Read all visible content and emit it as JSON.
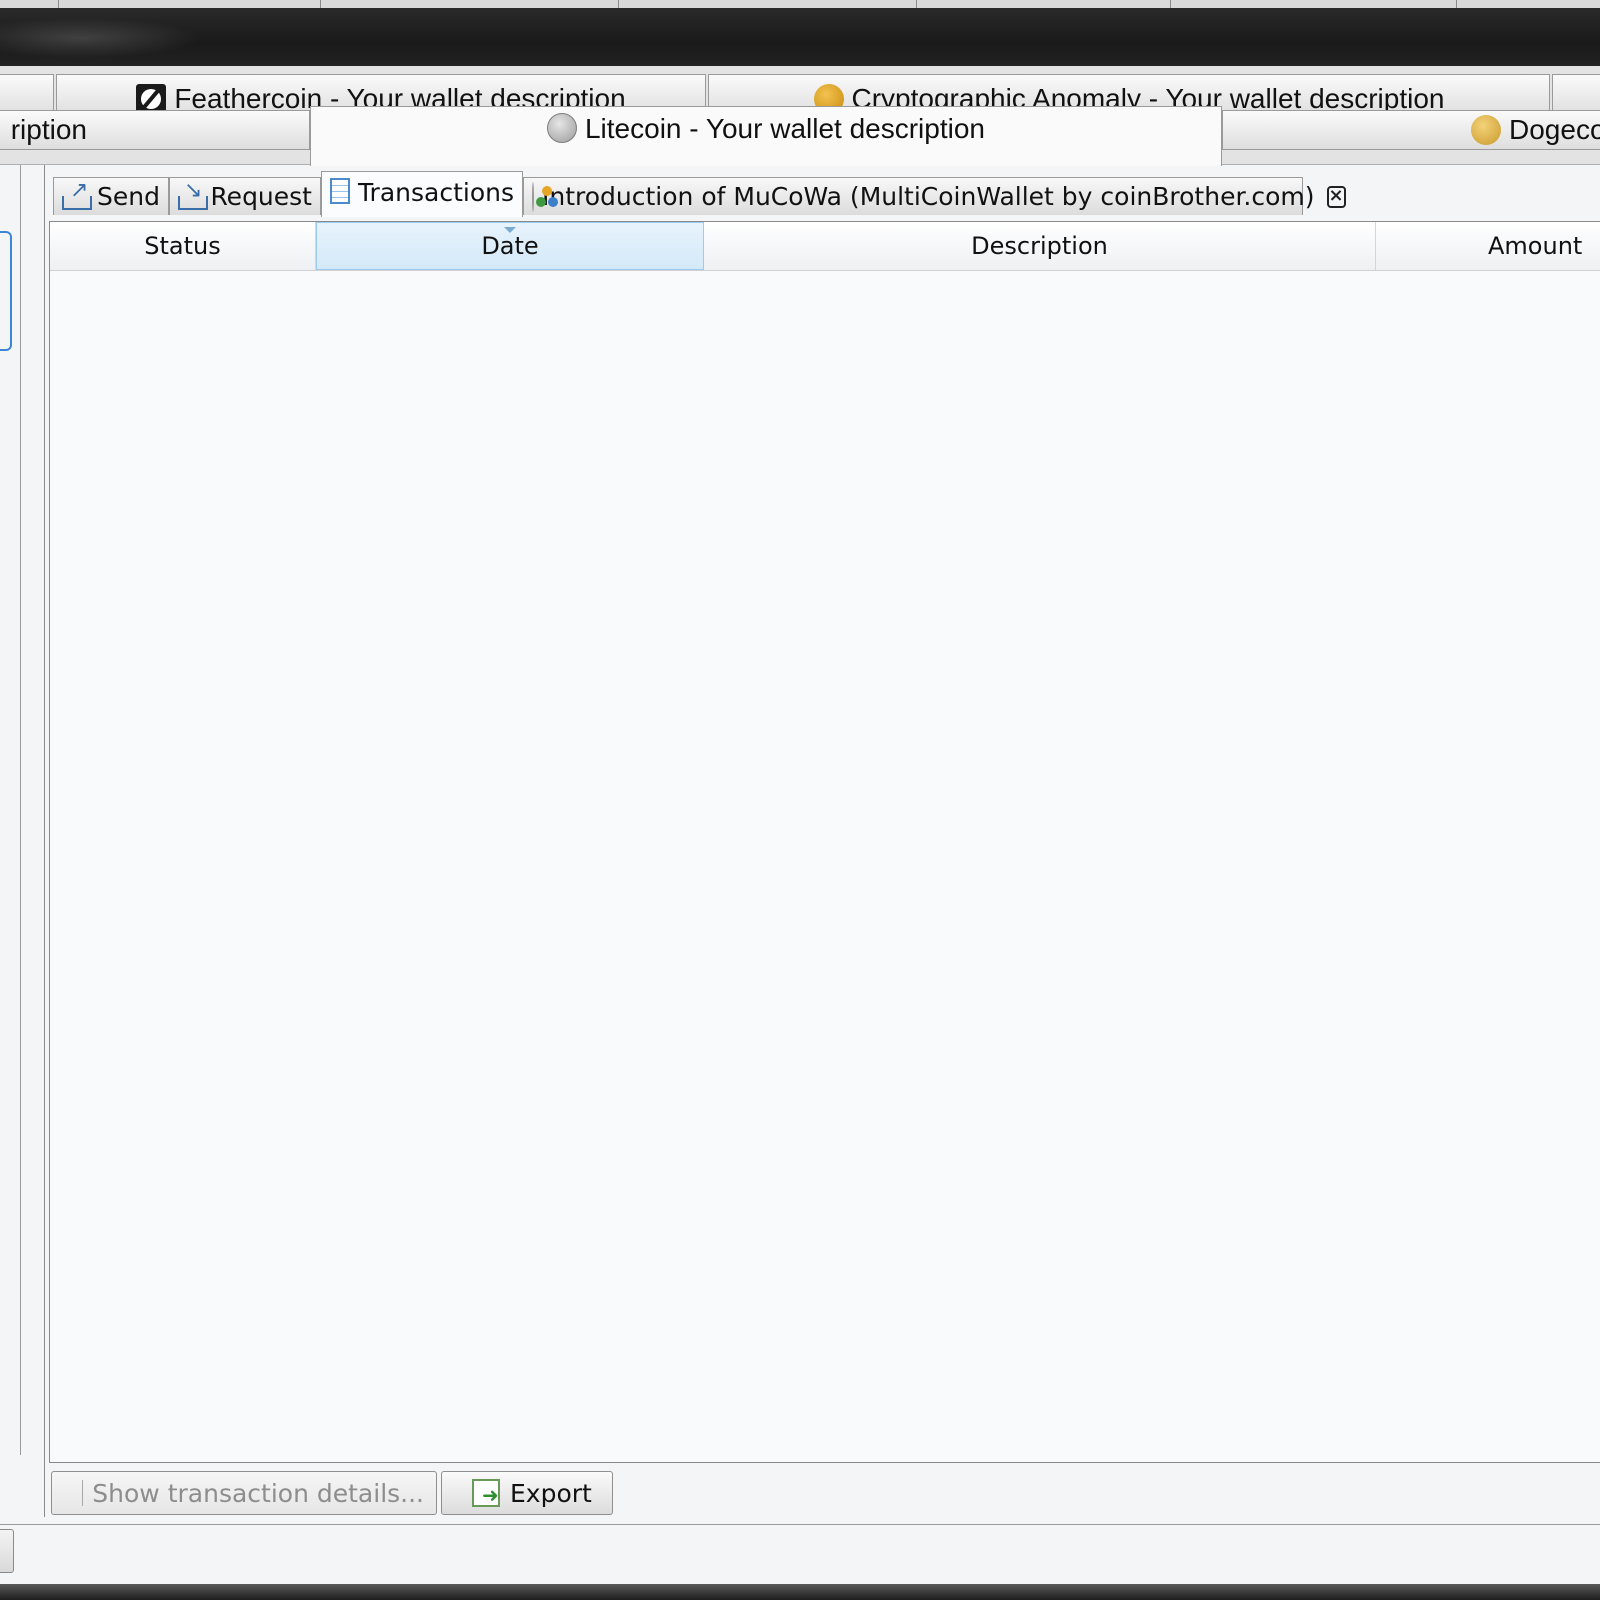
{
  "wallet_tabs": {
    "row1": [
      {
        "label": "",
        "icon": "none"
      },
      {
        "label": "Feathercoin - Your wallet description",
        "icon": "feathercoin-icon"
      },
      {
        "label": "Cryptographic Anomaly - Your wallet description",
        "icon": "cryptographic-anomaly-icon"
      },
      {
        "label": "",
        "icon": "none"
      }
    ],
    "row2": [
      {
        "label": "ription",
        "icon": "none"
      },
      {
        "label": "Litecoin - Your wallet description",
        "icon": "litecoin-icon",
        "active": true
      },
      {
        "label": "Dogeco",
        "icon": "dogecoin-icon"
      }
    ]
  },
  "subtabs": {
    "send": "Send",
    "request": "Request",
    "transactions": "Transactions",
    "intro": "Introduction of MuCoWa (MultiCoinWallet by coinBrother.com)"
  },
  "table": {
    "columns": [
      "Status",
      "Date",
      "Description",
      "Amount"
    ],
    "sorted_column": "Date",
    "rows": []
  },
  "buttons": {
    "show_details": "Show transaction details...",
    "export": "Export"
  },
  "colors": {
    "sort_header": "#d4e9f8",
    "focus_blue": "#3d86d6",
    "titlebar": "#1a1a1a"
  }
}
